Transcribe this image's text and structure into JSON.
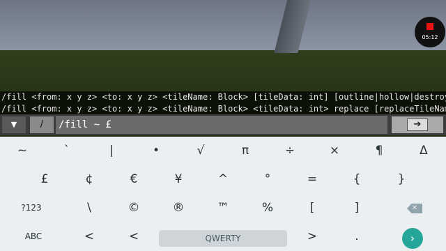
{
  "recording": {
    "time": "05:12"
  },
  "chat": {
    "lines": [
      "/fill <from: x y z> <to: x y z> <tileName: Block> [tileData: int] [outline|hollow|destroy|ke",
      "/fill <from: x y z> <to: x y z> <tileName: Block> <tileData: int> replace [replaceTileName"
    ]
  },
  "command": {
    "slash_label": "/",
    "input_value": "/fill ~ £",
    "send_label": "➔"
  },
  "keyboard": {
    "row1": [
      "~",
      "`",
      "|",
      "•",
      "√",
      "π",
      "÷",
      "×",
      "¶",
      "Δ"
    ],
    "row2": [
      "£",
      "¢",
      "€",
      "¥",
      "^",
      "°",
      "=",
      "{",
      "}"
    ],
    "row3": [
      "?123",
      "\\",
      "©",
      "®",
      "™",
      "%",
      "[",
      "]"
    ],
    "row4": [
      "ABC",
      "<",
      ">",
      "."
    ],
    "space_label": "QWERTY",
    "enter_icon": "arrow-right-icon",
    "backspace_icon": "backspace-icon"
  },
  "colors": {
    "enter": "#26a69a",
    "record_dot": "#ee1111"
  }
}
